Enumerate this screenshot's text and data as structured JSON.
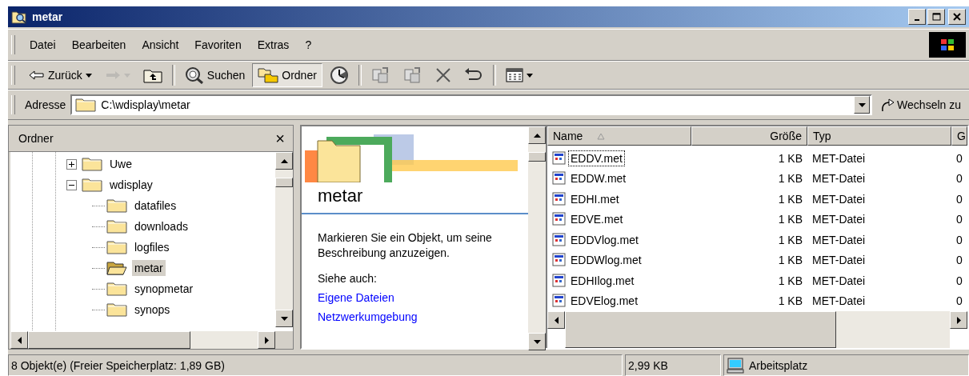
{
  "window": {
    "title": "metar"
  },
  "menu": [
    "Datei",
    "Bearbeiten",
    "Ansicht",
    "Favoriten",
    "Extras",
    "?"
  ],
  "toolbar": [
    {
      "kind": "back",
      "label": "Zurück",
      "disabled": false,
      "selected": false
    },
    {
      "kind": "forward",
      "disabled": true,
      "selected": false
    },
    {
      "kind": "up",
      "disabled": false,
      "selected": false
    },
    {
      "kind": "separator"
    },
    {
      "kind": "search",
      "label": "Suchen",
      "disabled": false,
      "selected": false
    },
    {
      "kind": "folders",
      "label": "Ordner",
      "disabled": false,
      "selected": true
    },
    {
      "kind": "history",
      "disabled": false,
      "selected": false
    },
    {
      "kind": "separator"
    },
    {
      "kind": "move",
      "disabled": false,
      "selected": false
    },
    {
      "kind": "copy",
      "disabled": false,
      "selected": false
    },
    {
      "kind": "delete",
      "disabled": false,
      "selected": false
    },
    {
      "kind": "undo",
      "disabled": false,
      "selected": false
    },
    {
      "kind": "separator"
    },
    {
      "kind": "views",
      "disabled": false,
      "selected": false
    }
  ],
  "address": {
    "label": "Adresse",
    "value": "C:\\wdisplay\\metar",
    "go": "Wechseln zu"
  },
  "folder_pane": {
    "title": "Ordner",
    "close": "×",
    "tree": [
      {
        "label": "Uwe",
        "expanded": false,
        "selected": false
      },
      {
        "label": "wdisplay",
        "expanded": true,
        "selected": false,
        "children": [
          {
            "label": "datafiles",
            "selected": false
          },
          {
            "label": "downloads",
            "selected": false
          },
          {
            "label": "logfiles",
            "selected": false
          },
          {
            "label": "metar",
            "selected": true
          },
          {
            "label": "synopmetar",
            "selected": false
          },
          {
            "label": "synops",
            "selected": false
          }
        ]
      }
    ]
  },
  "info_pane": {
    "title": "metar",
    "description": "Markieren Sie ein Objekt, um seine Beschreibung anzuzeigen.",
    "see_also": "Siehe auch:",
    "links": [
      "Eigene Dateien",
      "Netzwerkumgebung"
    ]
  },
  "file_list": {
    "columns": [
      {
        "label": "Name",
        "sorted": true
      },
      {
        "label": "Größe"
      },
      {
        "label": "Typ"
      },
      {
        "label": "G"
      }
    ],
    "rows": [
      {
        "name": "EDDV.met",
        "size": "1 KB",
        "type": "MET-Datei",
        "column_4": "0",
        "focused": true
      },
      {
        "name": "EDDW.met",
        "size": "1 KB",
        "type": "MET-Datei",
        "column_4": "0",
        "focused": false
      },
      {
        "name": "EDHI.met",
        "size": "1 KB",
        "type": "MET-Datei",
        "column_4": "0",
        "focused": false
      },
      {
        "name": "EDVE.met",
        "size": "1 KB",
        "type": "MET-Datei",
        "column_4": "0",
        "focused": false
      },
      {
        "name": "EDDVlog.met",
        "size": "1 KB",
        "type": "MET-Datei",
        "column_4": "0",
        "focused": false
      },
      {
        "name": "EDDWlog.met",
        "size": "1 KB",
        "type": "MET-Datei",
        "column_4": "0",
        "focused": false
      },
      {
        "name": "EDHIlog.met",
        "size": "1 KB",
        "type": "MET-Datei",
        "column_4": "0",
        "focused": false
      },
      {
        "name": "EDVElog.met",
        "size": "1 KB",
        "type": "MET-Datei",
        "column_4": "0",
        "focused": false
      }
    ]
  },
  "status_bar": {
    "objects": "8 Objekt(e)  (Freier Speicherplatz: 1,89 GB)",
    "size": "2,99 KB",
    "zone": "Arbeitsplatz"
  }
}
